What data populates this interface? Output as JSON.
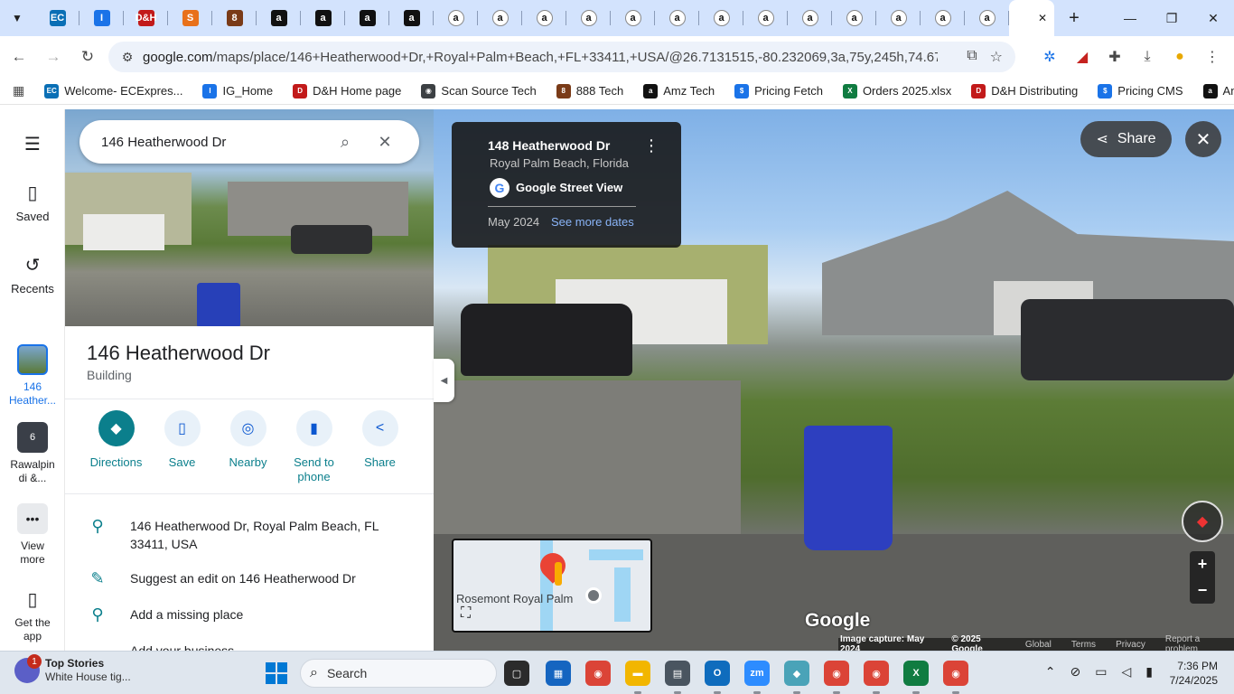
{
  "browser": {
    "tabs": [
      {
        "icon": "ec-icon",
        "color": "#0a6fb5",
        "glyph": "EC"
      },
      {
        "icon": "ig-icon",
        "color": "#1a73e8",
        "glyph": "I"
      },
      {
        "icon": "dh-icon",
        "color": "#c21a1a",
        "glyph": "D&H"
      },
      {
        "icon": "scansource-icon",
        "color": "#e8711a",
        "glyph": "S"
      },
      {
        "icon": "888-icon",
        "color": "#7a3b18",
        "glyph": "8"
      },
      {
        "icon": "amazon-icon",
        "color": "#111111",
        "glyph": "a"
      },
      {
        "icon": "amazon-icon",
        "color": "#111111",
        "glyph": "a"
      },
      {
        "icon": "amazon-icon",
        "color": "#111111",
        "glyph": "a"
      },
      {
        "icon": "amazon-icon",
        "color": "#111111",
        "glyph": "a"
      },
      {
        "icon": "amazon-smile-icon",
        "color": "#ffffff",
        "glyph": "a"
      },
      {
        "icon": "amazon-smile-icon",
        "color": "#ffffff",
        "glyph": "a"
      },
      {
        "icon": "amazon-smile-icon",
        "color": "#ffffff",
        "glyph": "a"
      },
      {
        "icon": "amazon-smile-icon",
        "color": "#ffffff",
        "glyph": "a"
      },
      {
        "icon": "amazon-smile-icon",
        "color": "#ffffff",
        "glyph": "a"
      },
      {
        "icon": "amazon-smile-icon",
        "color": "#ffffff",
        "glyph": "a"
      },
      {
        "icon": "amazon-smile-icon",
        "color": "#ffffff",
        "glyph": "a"
      },
      {
        "icon": "amazon-smile-icon",
        "color": "#ffffff",
        "glyph": "a"
      },
      {
        "icon": "amazon-smile-icon",
        "color": "#ffffff",
        "glyph": "a"
      },
      {
        "icon": "amazon-smile-icon",
        "color": "#ffffff",
        "glyph": "a"
      },
      {
        "icon": "amazon-smile-icon",
        "color": "#ffffff",
        "glyph": "a"
      },
      {
        "icon": "amazon-smile-icon",
        "color": "#ffffff",
        "glyph": "a"
      },
      {
        "icon": "amazon-smile-icon",
        "color": "#ffffff",
        "glyph": "a"
      }
    ],
    "url_host": "google.com",
    "url_path": "/maps/place/146+Heatherwood+Dr,+Royal+Palm+Beach,+FL+33411,+USA/@26.7131515,-80.232069,3a,75y,245h,74.67t/data=!3...",
    "bookmarks": [
      {
        "label": "Welcome- ECExpres...",
        "icon": "ec-icon",
        "color": "#0a6fb5",
        "glyph": "EC"
      },
      {
        "label": "IG_Home",
        "icon": "ig-icon",
        "color": "#1a73e8",
        "glyph": "I"
      },
      {
        "label": "D&H Home page",
        "icon": "dh-icon",
        "color": "#c21a1a",
        "glyph": "D"
      },
      {
        "label": "Scan Source Tech",
        "icon": "globe-icon",
        "color": "#3c4043",
        "glyph": "◉"
      },
      {
        "label": "888 Tech",
        "icon": "888-icon",
        "color": "#7a3b18",
        "glyph": "8"
      },
      {
        "label": "Amz Tech",
        "icon": "amazon-icon",
        "color": "#111111",
        "glyph": "a"
      },
      {
        "label": "Pricing Fetch",
        "icon": "pricing-icon",
        "color": "#1a73e8",
        "glyph": "$"
      },
      {
        "label": "Orders 2025.xlsx",
        "icon": "excel-icon",
        "color": "#107c41",
        "glyph": "X"
      },
      {
        "label": "D&H Distributing",
        "icon": "dh-icon",
        "color": "#c21a1a",
        "glyph": "D"
      },
      {
        "label": "Pricing CMS",
        "icon": "pricing-icon",
        "color": "#1a73e8",
        "glyph": "$"
      },
      {
        "label": "Amazon",
        "icon": "amazon-icon",
        "color": "#111111",
        "glyph": "a"
      }
    ]
  },
  "rail": {
    "saved": "Saved",
    "recents": "Recents",
    "recent1": "146 Heather...",
    "recent2": "Rawalpin di &...",
    "recent2_count": "6",
    "view_more": "View more",
    "get_app": "Get the app"
  },
  "panel": {
    "search_value": "146 Heatherwood Dr",
    "title": "146 Heatherwood Dr",
    "subtitle": "Building",
    "actions": [
      {
        "label": "Directions",
        "icon": "directions-icon",
        "glyph": "◆"
      },
      {
        "label": "Save",
        "icon": "bookmark-icon",
        "glyph": "▯"
      },
      {
        "label": "Nearby",
        "icon": "nearby-icon",
        "glyph": "◎"
      },
      {
        "label": "Send to phone",
        "icon": "send-to-phone-icon",
        "glyph": "▮"
      },
      {
        "label": "Share",
        "icon": "share-icon",
        "glyph": "<"
      }
    ],
    "address": "146 Heatherwood Dr, Royal Palm Beach, FL 33411, USA",
    "suggest_edit": "Suggest an edit on 146 Heatherwood Dr",
    "add_place": "Add a missing place",
    "add_business": "Add your business"
  },
  "streetview": {
    "card_title": "148 Heatherwood Dr",
    "card_location": "Royal Palm Beach, Florida",
    "card_source": "Google Street View",
    "card_date": "May 2024",
    "card_more_dates": "See more dates",
    "share_label": "Share",
    "minimap_label": "Rosemont Royal Palm",
    "watermark": "Google",
    "footer": {
      "capture": "Image capture: May 2024",
      "copyright": "© 2025 Google",
      "global": "Global",
      "terms": "Terms",
      "privacy": "Privacy",
      "report": "Report a problem"
    }
  },
  "taskbar": {
    "news_title": "Top Stories",
    "news_sub": "White House tig...",
    "news_badge": "1",
    "search_placeholder": "Search",
    "time": "7:36 PM",
    "date": "7/24/2025",
    "apps": [
      {
        "icon": "task-view-icon",
        "color": "#2b2b2b",
        "glyph": "▢",
        "run": false
      },
      {
        "icon": "store-icon",
        "color": "#1565c0",
        "glyph": "▦",
        "run": false
      },
      {
        "icon": "chrome-icon",
        "color": "#db4437",
        "glyph": "◉",
        "run": false
      },
      {
        "icon": "file-explorer-icon",
        "color": "#f2b600",
        "glyph": "▬",
        "run": true
      },
      {
        "icon": "calculator-icon",
        "color": "#4a5560",
        "glyph": "▤",
        "run": true
      },
      {
        "icon": "outlook-icon",
        "color": "#0f6cbd",
        "glyph": "O",
        "run": true
      },
      {
        "icon": "zoom-icon",
        "color": "#2d8cff",
        "glyph": "zm",
        "run": true
      },
      {
        "icon": "edge-like-icon",
        "color": "#4aa3b8",
        "glyph": "◆",
        "run": true
      },
      {
        "icon": "chrome-profile-icon",
        "color": "#db4437",
        "glyph": "◉",
        "run": true
      },
      {
        "icon": "chrome-profile-icon",
        "color": "#db4437",
        "glyph": "◉",
        "run": true
      },
      {
        "icon": "excel-icon",
        "color": "#107c41",
        "glyph": "X",
        "run": true
      },
      {
        "icon": "chrome-profile-icon",
        "color": "#db4437",
        "glyph": "◉",
        "run": true
      }
    ]
  }
}
